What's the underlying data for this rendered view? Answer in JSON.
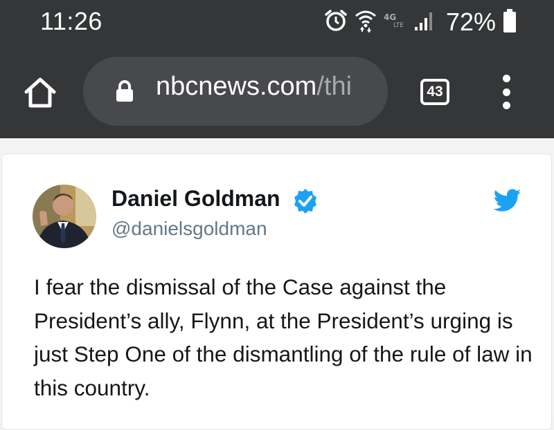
{
  "status_bar": {
    "time": "11:26",
    "battery": "72%",
    "icons": [
      "alarm-icon",
      "wifi-icon",
      "volte-icon",
      "signal-icon",
      "battery-icon"
    ]
  },
  "browser": {
    "url_domain": "nbcnews.com",
    "url_path": "/thi",
    "tab_count": "43",
    "icons": [
      "home-icon",
      "lock-icon",
      "more-vert-icon"
    ]
  },
  "tweet": {
    "author_name": "Daniel Goldman",
    "handle": "@danielsgoldman",
    "verified": true,
    "text": "I fear the dismissal of the Case against the President’s ally, Flynn, at the President’s urging is just Step One of the dismantling of the rule of law in this country."
  },
  "colors": {
    "chrome_bg": "#343638",
    "urlbar_bg": "#48494c",
    "twitter_blue": "#1da1f2",
    "text": "#14171a",
    "handle_gray": "#657786"
  }
}
